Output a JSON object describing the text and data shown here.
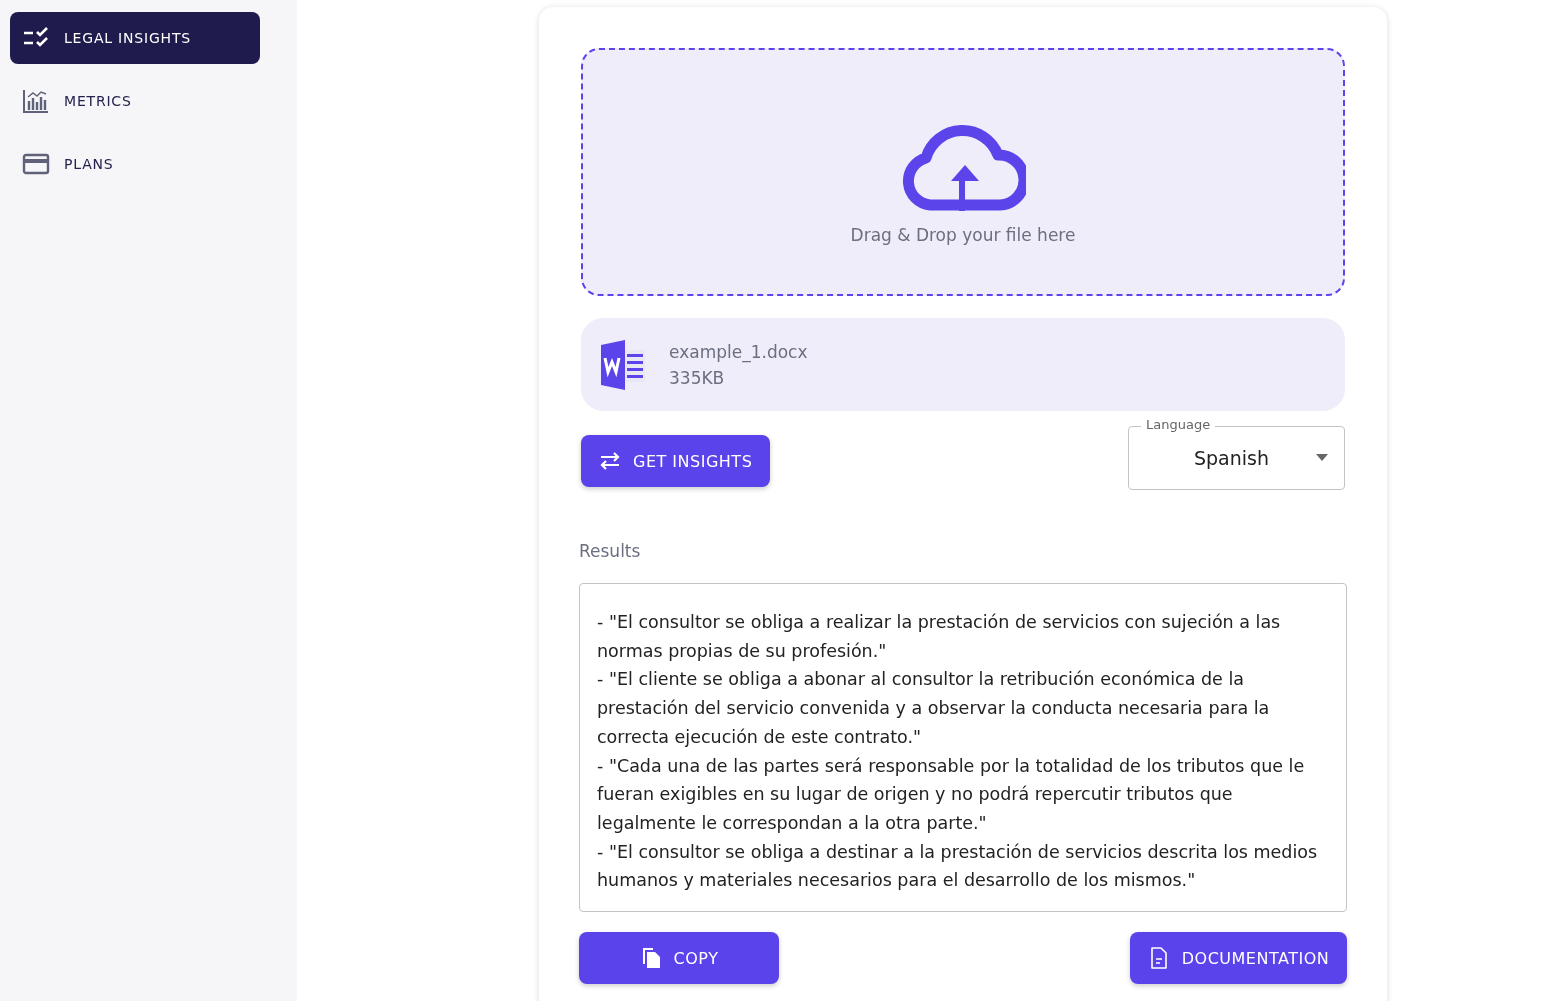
{
  "sidebar": {
    "items": [
      {
        "label": "LEGAL INSIGHTS",
        "selected": true
      },
      {
        "label": "METRICS",
        "selected": false
      },
      {
        "label": "PLANS",
        "selected": false
      }
    ]
  },
  "upload": {
    "prompt": "Drag & Drop your file here"
  },
  "file": {
    "name": "example_1.docx",
    "size": "335KB"
  },
  "get_insights_button": "GET INSIGHTS",
  "language": {
    "label": "Language",
    "value": "Spanish"
  },
  "results": {
    "label": "Results",
    "paragraphs": [
      "- \"El consultor se obliga a realizar la prestación de servicios con sujeción a las normas propias de su profesión.\"",
      "- \"El cliente se obliga a abonar al consultor la retribución económica de la prestación del servicio convenida y a observar la conducta necesaria para la correcta ejecución de este contrato.\"",
      "- \"Cada una de las partes será responsable por la totalidad de los tributos que le fueran exigibles en su lugar de origen y no podrá repercutir tributos que legalmente le correspondan a la otra parte.\"",
      "- \"El consultor se obliga a destinar a la prestación de servicios descrita los medios humanos y materiales necesarios para el desarrollo de los mismos.\""
    ]
  },
  "buttons": [
    {
      "label": "COPY"
    },
    {
      "label": "DOCUMENTATION"
    }
  ]
}
